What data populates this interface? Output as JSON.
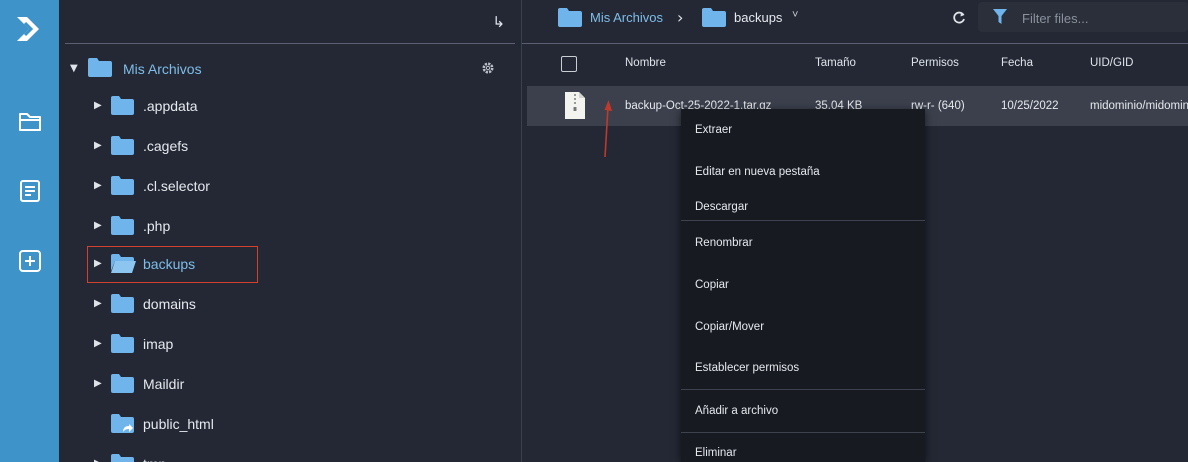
{
  "app": {
    "rail_icons": [
      "logo-icon",
      "folder-icon",
      "document-icon",
      "add-icon"
    ]
  },
  "tree": {
    "collapse_icon": "↳",
    "root_label": "Mis Archivos",
    "items": [
      {
        "label": ".appdata"
      },
      {
        "label": ".cagefs"
      },
      {
        "label": ".cl.selector"
      },
      {
        "label": ".php"
      },
      {
        "label": "backups"
      },
      {
        "label": "domains"
      },
      {
        "label": "imap"
      },
      {
        "label": "Maildir"
      },
      {
        "label": "public_html"
      },
      {
        "label": "tmp"
      }
    ]
  },
  "breadcrumb": {
    "root": "Mis Archivos",
    "separator": "›",
    "current": "backups",
    "dropdown": "˅"
  },
  "filter": {
    "placeholder": "Filter files..."
  },
  "table": {
    "headers": [
      "Nombre",
      "Tamaño",
      "Permisos",
      "Fecha",
      "UID/GID"
    ],
    "rows": [
      {
        "name": "backup-Oct-25-2022-1.tar.gz",
        "size": "35.04 KB",
        "perms": "rw-r- (640)",
        "date": "10/25/2022",
        "uid": "midominio/midominio"
      }
    ]
  },
  "context_menu": {
    "items": [
      "Extraer",
      "Editar en nueva pestaña",
      "Descargar",
      "Renombrar",
      "Copiar",
      "Copiar/Mover",
      "Establecer permisos",
      "Añadir a archivo",
      "Eliminar"
    ]
  },
  "colors": {
    "rail": "#3e93c9",
    "background": "#222733",
    "folder": "#6fb5ec",
    "highlight_box": "#d2412e",
    "annotation_arrow": "#c0392b",
    "selected_row": "#3b404c",
    "menu": "#171a21"
  }
}
